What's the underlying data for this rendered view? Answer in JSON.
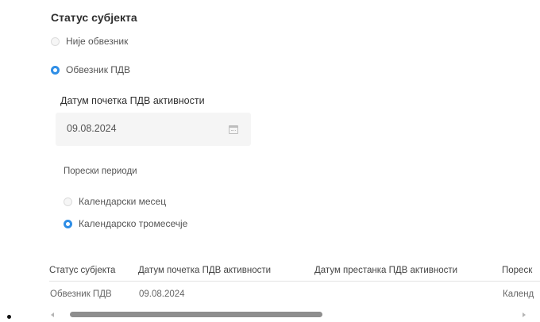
{
  "section": {
    "title": "Статус субјекта"
  },
  "status_options": [
    {
      "label": "Није обвезник",
      "selected": false
    },
    {
      "label": "Обвезник ПДВ",
      "selected": true
    }
  ],
  "date_field": {
    "label": "Датум почетка ПДВ активности",
    "value": "09.08.2024",
    "icon": "calendar-icon"
  },
  "periods": {
    "label": "Порески периоди",
    "options": [
      {
        "label": "Календарски месец",
        "selected": false
      },
      {
        "label": "Календарско тромесечје",
        "selected": true
      }
    ]
  },
  "table": {
    "headers": [
      "Статус субјекта",
      "Датум почетка ПДВ активности",
      "Датум престанка ПДВ активности",
      "Пореск"
    ],
    "row": [
      "Обвезник ПДВ",
      "09.08.2024",
      "",
      "Календ"
    ]
  },
  "colors": {
    "accent": "#2f8ee6"
  }
}
